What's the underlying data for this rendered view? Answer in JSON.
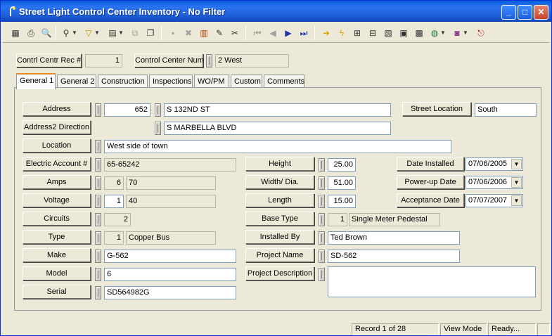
{
  "window": {
    "title": "Street Light Control Center Inventory - No Filter"
  },
  "header": {
    "rec_label": "Contrl Centr Rec #",
    "rec_value": "1",
    "num_label": "Control Center Num",
    "num_value": "2 West"
  },
  "tabs": [
    {
      "label": "General 1"
    },
    {
      "label": "General 2"
    },
    {
      "label": "Construction"
    },
    {
      "label": "Inspections"
    },
    {
      "label": "WO/PM"
    },
    {
      "label": "Custom"
    },
    {
      "label": "Comments"
    }
  ],
  "form": {
    "address": {
      "label": "Address",
      "number": "652",
      "street": "S 132ND ST"
    },
    "street_location": {
      "label": "Street Location",
      "value": "South"
    },
    "address2": {
      "label": "Address2 Direction",
      "street": "S MARBELLA BLVD"
    },
    "location": {
      "label": "Location",
      "value": "West side of town"
    },
    "electric_account": {
      "label": "Electric Account #",
      "value": "65-65242"
    },
    "amps": {
      "label": "Amps",
      "code": "6",
      "value": "70"
    },
    "voltage": {
      "label": "Voltage",
      "code": "1",
      "value": "40"
    },
    "circuits": {
      "label": "Circuits",
      "value": "2"
    },
    "type": {
      "label": "Type",
      "code": "1",
      "value": "Copper Bus"
    },
    "make": {
      "label": "Make",
      "value": "G-562"
    },
    "model": {
      "label": "Model",
      "value": "6"
    },
    "serial": {
      "label": "Serial",
      "value": "SD564982G"
    },
    "height": {
      "label": "Height",
      "value": "25.00"
    },
    "width": {
      "label": "Width/ Dia.",
      "value": "51.00"
    },
    "length": {
      "label": "Length",
      "value": "15.00"
    },
    "base_type": {
      "label": "Base Type",
      "code": "1",
      "value": "Single Meter Pedestal"
    },
    "installed_by": {
      "label": "Installed By",
      "value": "Ted Brown"
    },
    "project_name": {
      "label": "Project Name",
      "value": "SD-562"
    },
    "project_description": {
      "label": "Project Description",
      "value": ""
    },
    "date_installed": {
      "label": "Date Installed",
      "value": "07/06/2005"
    },
    "powerup_date": {
      "label": "Power-up Date",
      "value": "07/06/2006"
    },
    "acceptance_date": {
      "label": "Acceptance Date",
      "value": "07/07/2007"
    }
  },
  "status": {
    "record": "Record 1 of 28",
    "mode": "View Mode",
    "state": "Ready..."
  },
  "colors": {
    "title_bar": "#2b73ef",
    "tab_accent": "#e68b2c",
    "window_bg": "#ece9d8"
  }
}
